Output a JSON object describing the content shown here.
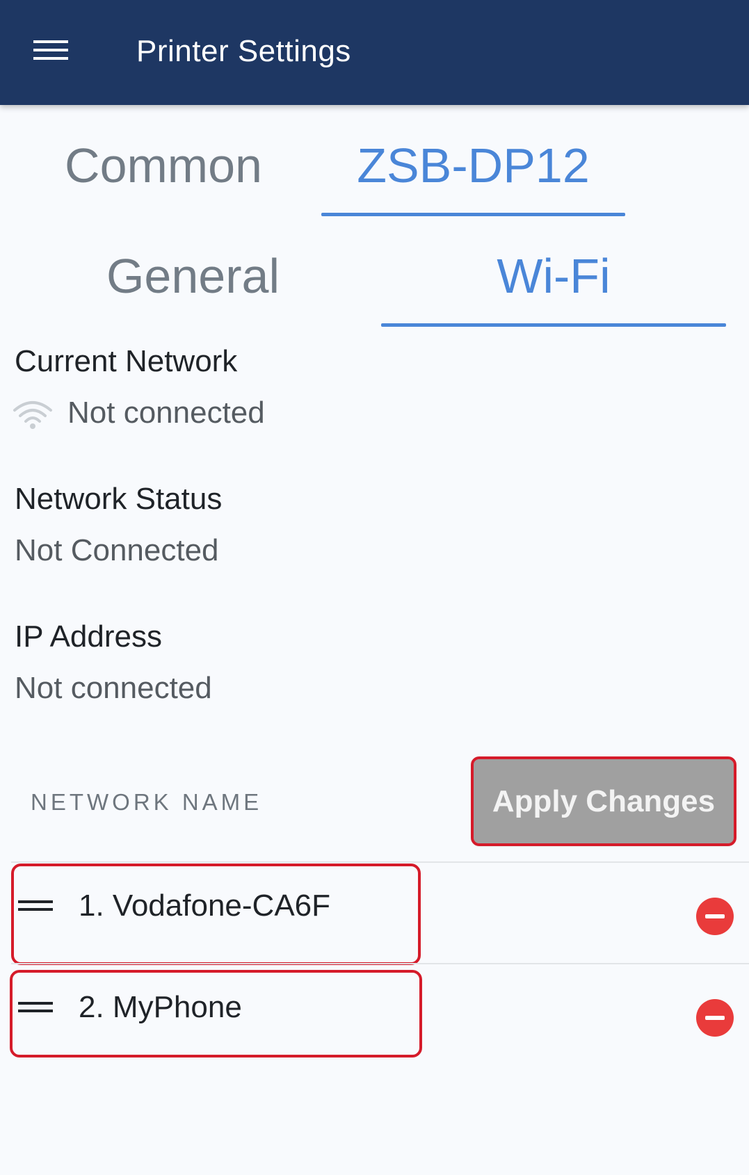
{
  "header": {
    "title": "Printer Settings",
    "menu_icon": "hamburger-menu-icon",
    "background": "#1e3763"
  },
  "tabs_primary": [
    {
      "label": "Common",
      "active": false
    },
    {
      "label": "ZSB-DP12",
      "active": true
    }
  ],
  "tabs_secondary": [
    {
      "label": "General",
      "active": false
    },
    {
      "label": "Wi-Fi",
      "active": true
    }
  ],
  "current_network": {
    "label": "Current Network",
    "value": "Not connected",
    "icon": "wifi-icon"
  },
  "network_status": {
    "label": "Network Status",
    "value": "Not Connected"
  },
  "ip_address": {
    "label": "IP Address",
    "value": "Not connected"
  },
  "network_list": {
    "column_header": "NETWORK NAME",
    "apply_label": "Apply Changes",
    "items": [
      {
        "name": "1. Vodafone-CA6F"
      },
      {
        "name": "2. MyPhone"
      }
    ]
  },
  "colors": {
    "accent": "#4a86d8",
    "remove": "#e93b3b",
    "highlight": "#d51b2a",
    "apply_disabled": "#a0a0a0"
  }
}
